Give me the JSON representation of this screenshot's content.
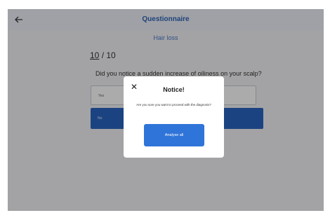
{
  "header": {
    "title": "Questionnaire",
    "back_icon": "arrow-left-icon"
  },
  "section": {
    "title": "Hair loss"
  },
  "progress": {
    "current": "10",
    "separator": " / ",
    "total": "10"
  },
  "question": {
    "text": "Did you notice a sudden increase of oiliness on your scalp?"
  },
  "options": {
    "yes": "Yes",
    "no": "No"
  },
  "modal": {
    "title": "Notice!",
    "message": "Are you sure you want to proceed with the diagnosis?",
    "button": "Analyse all",
    "close_icon": "close-icon"
  },
  "colors": {
    "accent": "#2b64c0",
    "title": "#2f63b8",
    "button": "#2f74d8"
  }
}
